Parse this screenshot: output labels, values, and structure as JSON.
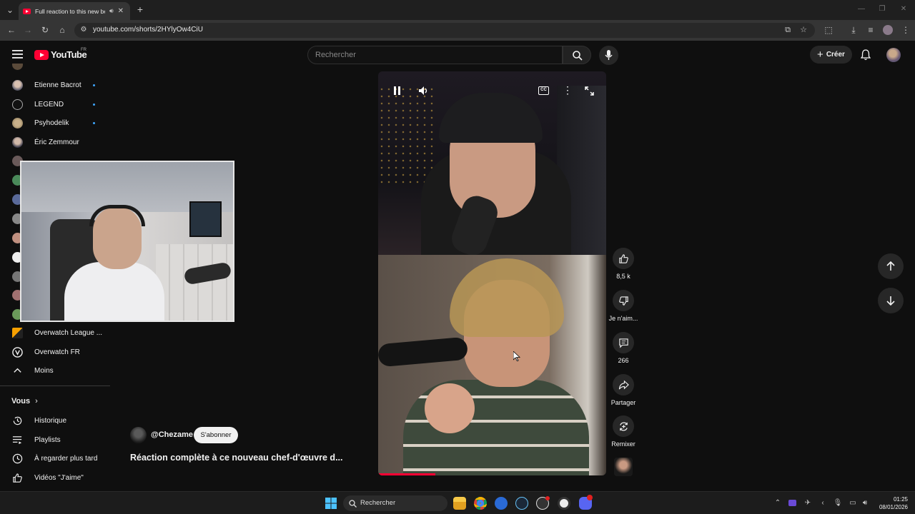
{
  "browser": {
    "tab_title": "Full reaction to this new be",
    "url": "youtube.com/shorts/2HYlyOw4CiU"
  },
  "header": {
    "logo_text": "YouTube",
    "region": "FR",
    "search_placeholder": "Rechercher",
    "create_label": "Créer"
  },
  "sidebar": {
    "items": [
      {
        "label": "Etienne Bacrot",
        "new": true
      },
      {
        "label": "LEGEND",
        "new": true
      },
      {
        "label": "Psyhodelik",
        "new": true
      },
      {
        "label": "Éric Zemmour",
        "new": false
      },
      {
        "label": "Overwatch League ...",
        "new": false
      },
      {
        "label": "Overwatch FR",
        "new": false
      }
    ],
    "less_label": "Moins",
    "you_label": "Vous",
    "you_items": [
      {
        "label": "Historique",
        "icon": "history-icon"
      },
      {
        "label": "Playlists",
        "icon": "playlists-icon"
      },
      {
        "label": "À regarder plus tard",
        "icon": "watch-later-icon"
      },
      {
        "label": "Vidéos \"J'aime\"",
        "icon": "thumb-up-icon"
      }
    ]
  },
  "short": {
    "channel": "@Chezame",
    "subscribe_label": "S'abonner",
    "title": "Réaction complète à ce nouveau chef-d'œuvre d...",
    "progress": 0.25,
    "actions": {
      "like_count": "8,5 k",
      "dislike_label": "Je n'aim...",
      "comment_count": "266",
      "share_label": "Partager",
      "remix_label": "Remixer"
    }
  },
  "taskbar": {
    "search_label": "Rechercher",
    "time": "01:25",
    "date": "08/01/2026"
  },
  "colors": {
    "accent": "#ff0033",
    "background": "#0f0f0f",
    "new_dot": "#3ea6ff"
  }
}
